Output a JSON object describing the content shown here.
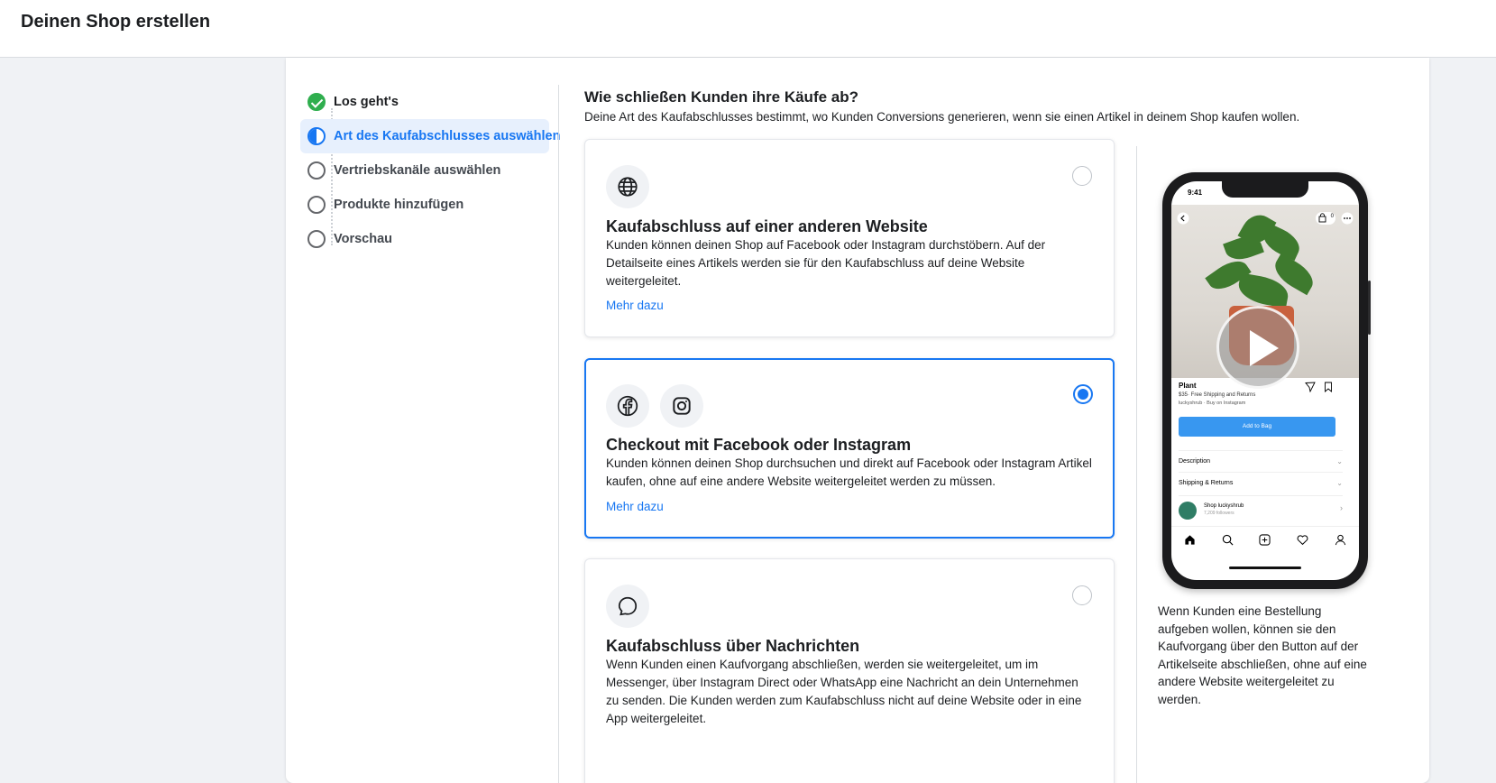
{
  "header": {
    "title": "Deinen Shop erstellen"
  },
  "stepper": {
    "steps": [
      {
        "label": "Los geht's",
        "state": "done"
      },
      {
        "label": "Art des Kaufabschlusses auswählen",
        "state": "active"
      },
      {
        "label": "Vertriebskanäle auswählen",
        "state": "pending"
      },
      {
        "label": "Produkte hinzufügen",
        "state": "pending"
      },
      {
        "label": "Vorschau",
        "state": "pending"
      }
    ]
  },
  "main": {
    "title": "Wie schließen Kunden ihre Käufe ab?",
    "subtitle": "Deine Art des Kaufabschlusses bestimmt, wo Kunden Conversions generieren, wenn sie einen Artikel in deinem Shop kaufen wollen.",
    "options": [
      {
        "icons": [
          "globe-icon"
        ],
        "title": "Kaufabschluss auf einer anderen Website",
        "description": "Kunden können deinen Shop auf Facebook oder Instagram durchstöbern. Auf der Detailseite eines Artikels werden sie für den Kaufabschluss auf deine Website weitergeleitet.",
        "link": "Mehr dazu",
        "selected": false
      },
      {
        "icons": [
          "facebook-icon",
          "instagram-icon"
        ],
        "title": "Checkout mit Facebook oder Instagram",
        "description": "Kunden können deinen Shop durchsuchen und direkt auf Facebook oder Instagram Artikel kaufen, ohne auf eine andere Website weitergeleitet werden zu müssen.",
        "link": "Mehr dazu",
        "selected": true
      },
      {
        "icons": [
          "chat-bubble-icon"
        ],
        "title": "Kaufabschluss über Nachrichten",
        "description": "Wenn Kunden einen Kaufvorgang abschließen, werden sie weitergeleitet, um im Messenger, über Instagram Direct oder WhatsApp eine Nachricht an dein Unternehmen zu senden. Die Kunden werden zum Kaufabschluss nicht auf deine Website oder in eine App weitergeleitet.",
        "selected": false
      }
    ]
  },
  "preview": {
    "phone": {
      "time": "9:41",
      "bag_count": "0",
      "product_name": "Plant",
      "product_meta": "$35· Free Shipping and Returns",
      "product_meta2": "luckyshrub · Buy on Instagram",
      "add_to_bag": "Add to Bag",
      "rows": [
        "Description",
        "Shipping & Returns"
      ],
      "shop_name": "Shop luckyshrub",
      "shop_followers": "7,209 followers"
    },
    "text": "Wenn Kunden eine Bestellung aufgeben wollen, können sie den Kaufvorgang über den Button auf der Artikelseite abschließen, ohne auf eine andere Website weitergeleitet zu werden."
  },
  "colors": {
    "accent": "#1877f2",
    "done": "#2fae4e",
    "background": "#f0f2f5"
  }
}
